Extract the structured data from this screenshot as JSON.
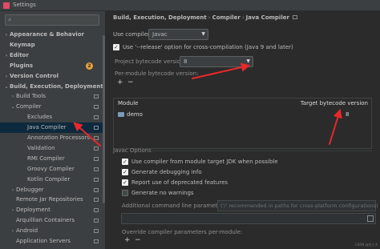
{
  "window": {
    "title": "Settings"
  },
  "sidebar": {
    "items": [
      {
        "label": "Appearance & Behavior",
        "arrow": ">",
        "bold": true
      },
      {
        "label": "Keymap",
        "arrow": "",
        "bold": true
      },
      {
        "label": "Editor",
        "arrow": ">",
        "bold": true
      },
      {
        "label": "Plugins",
        "arrow": "",
        "bold": true,
        "badge": "2"
      },
      {
        "label": "Version Control",
        "arrow": ">",
        "bold": true
      },
      {
        "label": "Build, Execution, Deployment",
        "arrow": "v",
        "bold": true
      },
      {
        "label": "Build Tools",
        "arrow": ">"
      },
      {
        "label": "Compiler",
        "arrow": "v"
      },
      {
        "label": "Excludes",
        "arrow": ""
      },
      {
        "label": "Java Compiler",
        "arrow": "",
        "selected": true
      },
      {
        "label": "Annotation Processors",
        "arrow": ""
      },
      {
        "label": "Validation",
        "arrow": ""
      },
      {
        "label": "RMI Compiler",
        "arrow": ""
      },
      {
        "label": "Groovy Compiler",
        "arrow": ""
      },
      {
        "label": "Kotlin Compiler",
        "arrow": ""
      },
      {
        "label": "Debugger",
        "arrow": ">"
      },
      {
        "label": "Remote Jar Repositories",
        "arrow": ""
      },
      {
        "label": "Deployment",
        "arrow": ">"
      },
      {
        "label": "Arquillian Containers",
        "arrow": ""
      },
      {
        "label": "Android",
        "arrow": ">"
      },
      {
        "label": "Application Servers",
        "arrow": ""
      }
    ]
  },
  "breadcrumb": {
    "parts": [
      "Build, Execution, Deployment",
      "Compiler",
      "Java Compiler"
    ],
    "separator": "›"
  },
  "compiler": {
    "use_label": "Use compiler:",
    "use_value": "Javac",
    "release_label": "Use '--release' option for cross-compilation (Java 9 and later)",
    "release_checked": true,
    "bytecode_label": "Project bytecode version:",
    "bytecode_value": "8",
    "per_module_label": "Per-module bytecode version:",
    "add_symbol": "+",
    "remove_symbol": "−"
  },
  "table": {
    "col_module": "Module",
    "col_target": "Target bytecode version",
    "rows": [
      {
        "module": "demo",
        "target": "8"
      }
    ]
  },
  "javac_options": {
    "section_label": "Javac Options",
    "options": [
      {
        "label": "Use compiler from module target JDK when possible",
        "checked": true
      },
      {
        "label": "Generate debugging info",
        "checked": true
      },
      {
        "label": "Report use of deprecated features",
        "checked": true
      },
      {
        "label": "Generate no warnings",
        "checked": false
      }
    ],
    "additional_label": "Additional command line parameters:",
    "additional_placeholder": "('/' recommended in paths for cross-platform configurations)",
    "override_label": "Override compiler parameters per-module:",
    "add_symbol": "+",
    "remove_symbol": "−"
  },
  "watermark": "CSDN @芝士大",
  "colors": {
    "annotation_arrow": "#e8282b",
    "selection": "#0d293e",
    "badge": "#e8a33d"
  }
}
